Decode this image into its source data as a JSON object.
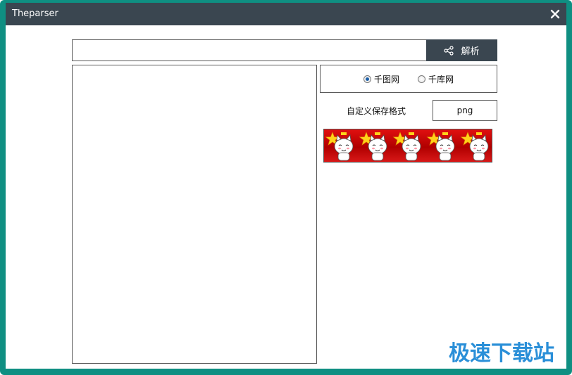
{
  "window": {
    "title": "Theparser",
    "close_glyph": "✕"
  },
  "toolbar": {
    "url_value": "",
    "parse_label": "解析",
    "parse_icon": "share-icon"
  },
  "output": {
    "text": ""
  },
  "source_options": [
    {
      "label": "千图网",
      "selected": true
    },
    {
      "label": "千库网",
      "selected": false
    }
  ],
  "format": {
    "label": "自定义保存格式",
    "value": "png"
  },
  "banner": {
    "icon": "cat-with-star-icon",
    "background_color": "#cc0000"
  },
  "watermark": {
    "text": "极速下载站"
  },
  "colors": {
    "titlebar": "#3a4650",
    "frame": "#0f8f82",
    "button": "#3a4650",
    "watermark": "#2a8fd8"
  }
}
